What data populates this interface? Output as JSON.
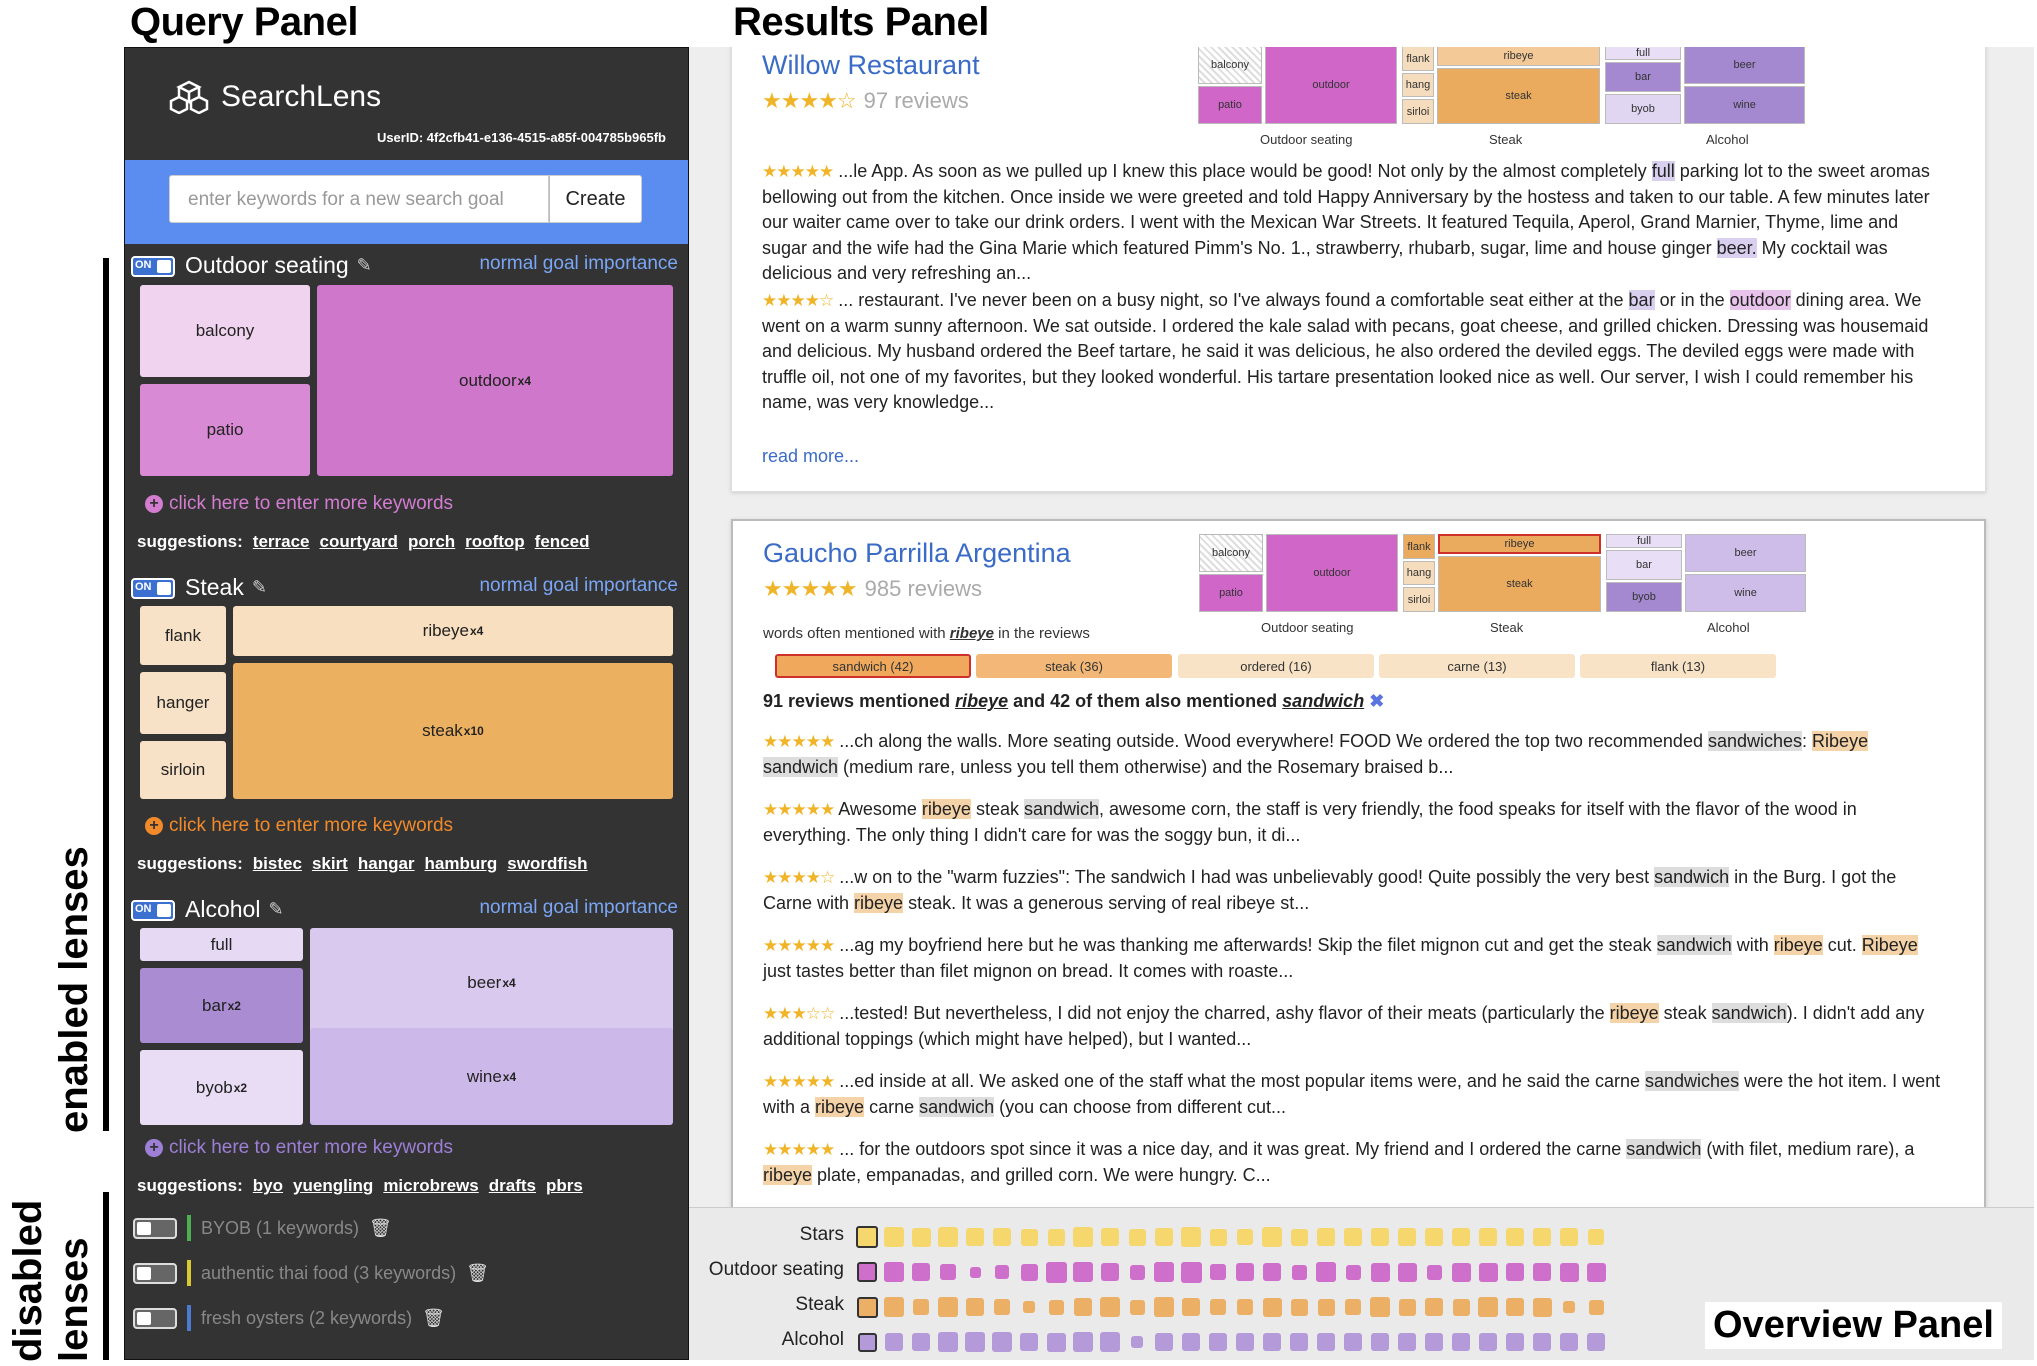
{
  "panel_labels": {
    "query": "Query Panel",
    "results": "Results Panel",
    "overview": "Overview Panel",
    "enabled": "enabled lenses",
    "disabled_1": "disabled",
    "disabled_2": "lenses"
  },
  "app": {
    "name": "SearchLens",
    "user_id": "UserID: 4f2cfb41-e136-4515-a85f-004785b965fb",
    "new_goal_placeholder": "enter keywords for a new search goal",
    "create_label": "Create"
  },
  "goals": [
    {
      "toggle": "ON",
      "title": "Outdoor seating",
      "importance": "normal goal importance",
      "color": "#cf7fcc",
      "keywords": [
        {
          "label": "balcony",
          "mult": ""
        },
        {
          "label": "patio",
          "mult": ""
        },
        {
          "label": "outdoor",
          "mult": "x4"
        }
      ],
      "more": "click here to enter more keywords",
      "suggestions_label": "suggestions:",
      "suggestions": [
        "terrace",
        "courtyard",
        "porch",
        "rooftop",
        "fenced"
      ]
    },
    {
      "toggle": "ON",
      "title": "Steak",
      "importance": "normal goal importance",
      "color": "#ebb066",
      "keywords": [
        {
          "label": "flank",
          "mult": ""
        },
        {
          "label": "hanger",
          "mult": ""
        },
        {
          "label": "sirloin",
          "mult": ""
        },
        {
          "label": "ribeye",
          "mult": "x4"
        },
        {
          "label": "steak",
          "mult": "x10"
        }
      ],
      "more": "click here to enter more keywords",
      "suggestions_label": "suggestions:",
      "suggestions": [
        "bistec",
        "skirt",
        "hangar",
        "hamburg",
        "swordfish"
      ]
    },
    {
      "toggle": "ON",
      "title": "Alcohol",
      "importance": "normal goal importance",
      "color": "#b59ad9",
      "keywords": [
        {
          "label": "full",
          "mult": ""
        },
        {
          "label": "bar",
          "mult": "x2"
        },
        {
          "label": "byob",
          "mult": "x2"
        },
        {
          "label": "beer",
          "mult": "x4"
        },
        {
          "label": "wine",
          "mult": "x4"
        }
      ],
      "more": "click here to enter more keywords",
      "suggestions_label": "suggestions:",
      "suggestions": [
        "byo",
        "yuengling",
        "microbrews",
        "drafts",
        "pbrs"
      ]
    }
  ],
  "disabled_goals": [
    {
      "label": "BYOB (1 keywords)",
      "color": "#4caf50"
    },
    {
      "label": "authentic thai food (3 keywords)",
      "color": "#d6c932"
    },
    {
      "label": "fresh oysters (2 keywords)",
      "color": "#4a7bd0"
    }
  ],
  "treemap_labels": {
    "outdoor": "Outdoor seating",
    "steak": "Steak",
    "alcohol": "Alcohol",
    "balcony": "balcony",
    "patio": "patio",
    "outdoor_kw": "outdoor",
    "flank": "flank",
    "hang": "hang",
    "sirloi": "sirloi",
    "ribeye": "ribeye",
    "steak_kw": "steak",
    "full": "full",
    "bar": "bar",
    "byob": "byob",
    "beer": "beer",
    "wine": "wine"
  },
  "results": [
    {
      "name": "Willow Restaurant",
      "stars": "★★★★☆",
      "reviews": "97 reviews",
      "snippets": [
        {
          "stars": "★★★★★",
          "parts": [
            " ...le App. As soon as we pulled up I knew this place would be good! Not only by the almost completely ",
            "full",
            " parking lot to the sweet aromas bellowing out from the kitchen. Once inside we were greeted and told Happy Anniversary by the hostess and taken to our table. A few minutes later our waiter came over to take our drink orders. I went with the Mexican War Streets. It featured Tequila, Aperol, Grand Marnier, Thyme, lime and sugar and the wife had the Gina Marie which featured Pimm's No. 1., strawberry, rhubarb, sugar, lime and house ginger ",
            "beer.",
            " My cocktail was delicious and very refreshing an..."
          ]
        },
        {
          "stars": "★★★★☆",
          "parts": [
            " ... restaurant. I've never been on a busy night, so I've always found a comfortable seat either at the ",
            "bar",
            " or in the ",
            "outdoor",
            " dining area. We went on a warm sunny afternoon. We sat outside. I ordered the kale salad with pecans, goat cheese, and grilled chicken. Dressing was housemaid and delicious. My husband ordered the Beef tartare, he said it was delicious, he also ordered the deviled eggs. The deviled eggs were made with truffle oil, not one of my favorites, but they looked wonderful. His tartare presentation looked nice as well. Our server, I wish I could remember his name, was very knowledge..."
          ]
        }
      ],
      "read_more": "read more..."
    },
    {
      "name": "Gaucho Parrilla Argentina",
      "stars": "★★★★★",
      "reviews": "985 reviews",
      "assoc_prefix": "words often mentioned with ",
      "assoc_word": "ribeye",
      "assoc_suffix": " in the reviews",
      "assoc": [
        "sandwich (42)",
        "steak (36)",
        "ordered (16)",
        "carne (13)",
        "flank (13)"
      ],
      "summary_a": "91 reviews mentioned ",
      "summary_w1": "ribeye",
      "summary_b": " and 42 of them also mentioned ",
      "summary_w2": "sandwich",
      "summary_x": "✖",
      "snippets": [
        {
          "stars": "★★★★★",
          "parts": [
            " ...ch along the walls. More seating outside. Wood everywhere! FOOD We ordered the top two recommended ",
            "sandwiches",
            ": ",
            "Ribeye",
            " ",
            "sandwich",
            " (medium rare, unless you tell them otherwise) and the Rosemary braised b..."
          ]
        },
        {
          "stars": "★★★★★",
          "parts": [
            " Awesome ",
            "ribeye",
            " steak ",
            "sandwich",
            ", awesome corn, the staff is very friendly, the food speaks for itself with the flavor of the wood in everything. The only thing I didn't care for was the soggy bun, it di..."
          ]
        },
        {
          "stars": "★★★★☆",
          "parts": [
            " ...w on to the \"warm fuzzies\": The sandwich I had was unbelievably good! Quite possibly the very best ",
            "sandwich",
            " in the Burg. I got the Carne with ",
            "ribeye",
            " steak. It was a generous serving of real ribeye st..."
          ]
        },
        {
          "stars": "★★★★★",
          "parts": [
            " ...ag my boyfriend here but he was thanking me afterwards! Skip the filet mignon cut and get the steak ",
            "sandwich",
            " with ",
            "ribeye",
            " cut. ",
            "Ribeye",
            " just tastes better than filet mignon on bread. It comes with roaste..."
          ]
        },
        {
          "stars": "★★★☆☆",
          "parts": [
            " ...tested! But nevertheless, I did not enjoy the charred, ashy flavor of their meats (particularly the ",
            "ribeye",
            " steak ",
            "sandwich",
            "). I didn't add any additional toppings (which might have helped), but I wanted..."
          ]
        },
        {
          "stars": "★★★★★",
          "parts": [
            " ...ed inside at all. We asked one of the staff what the most popular items were, and he said the carne ",
            "sandwiches",
            " were the hot item. I went with a ",
            "ribeye",
            " carne ",
            "sandwich",
            " (you can choose from different cut..."
          ]
        },
        {
          "stars": "★★★★★",
          "parts": [
            " ... for the outdoors spot since it was a nice day, and it was great. My friend and I ordered the carne ",
            "sandwich",
            " (with filet, medium rare), a ",
            "ribeye",
            " plate, empanadas, and grilled corn. We were hungry. C..."
          ]
        }
      ]
    }
  ],
  "overview": {
    "rows": [
      "Stars",
      "Outdoor seating",
      "Steak",
      "Alcohol"
    ],
    "colors": [
      "#f5d76e",
      "#cf6fcc",
      "#ebb066",
      "#b59ad9"
    ],
    "levels": [
      [
        1.0,
        0.85,
        0.8,
        0.9,
        0.75,
        0.75,
        0.7,
        0.7,
        0.85,
        0.75,
        0.7,
        0.75,
        0.9,
        0.7,
        0.65,
        0.85,
        0.7,
        0.75,
        0.75,
        0.75,
        0.75,
        0.75,
        0.75,
        0.75,
        0.75,
        0.75,
        0.75,
        0.6
      ],
      [
        0.9,
        0.85,
        0.75,
        0.6,
        0.3,
        0.5,
        0.7,
        0.95,
        0.85,
        0.75,
        0.55,
        0.85,
        0.95,
        0.65,
        0.75,
        0.75,
        0.55,
        0.85,
        0.55,
        0.8,
        0.8,
        0.55,
        0.8,
        0.8,
        0.75,
        0.75,
        0.8,
        0.8
      ],
      [
        0.95,
        0.9,
        0.65,
        0.9,
        0.75,
        0.65,
        0.35,
        0.55,
        0.75,
        0.85,
        0.55,
        0.9,
        0.75,
        0.65,
        0.6,
        0.8,
        0.7,
        0.7,
        0.6,
        0.85,
        0.7,
        0.75,
        0.7,
        0.85,
        0.75,
        0.8,
        0.4,
        0.55
      ],
      [
        0.8,
        0.75,
        0.75,
        0.85,
        0.9,
        0.85,
        0.75,
        0.8,
        0.85,
        0.85,
        0.35,
        0.75,
        0.75,
        0.75,
        0.75,
        0.75,
        0.75,
        0.75,
        0.75,
        0.75,
        0.75,
        0.75,
        0.75,
        0.75,
        0.75,
        0.75,
        0.75,
        0.75
      ]
    ]
  }
}
